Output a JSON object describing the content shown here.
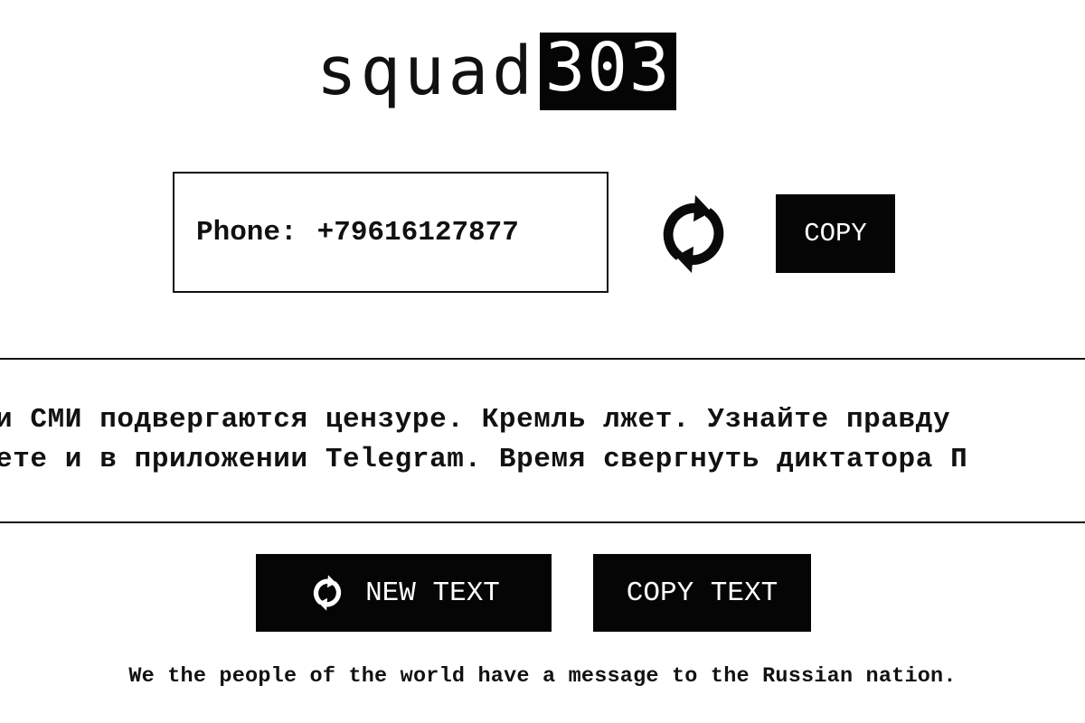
{
  "logo": {
    "word": "squad",
    "number": "303"
  },
  "phone": {
    "label": "Phone:",
    "value": "+79616127877"
  },
  "refresh_icon": "refresh-icon",
  "copy_button": {
    "label": "COPY"
  },
  "message": {
    "line_1": "и СМИ подвергаются цензуре. Кремль лжет. Узнайте правду",
    "line_2": "ете и в приложении Telegram. Время свергнуть диктатора П"
  },
  "actions": {
    "new_text_label": "NEW TEXT",
    "copy_text_label": "COPY TEXT"
  },
  "footer": {
    "text": "We the people of the world have a message to the Russian nation."
  },
  "colors": {
    "background": "#ffffff",
    "ink": "#111111",
    "button": "#050505",
    "button_text": "#ffffff"
  }
}
